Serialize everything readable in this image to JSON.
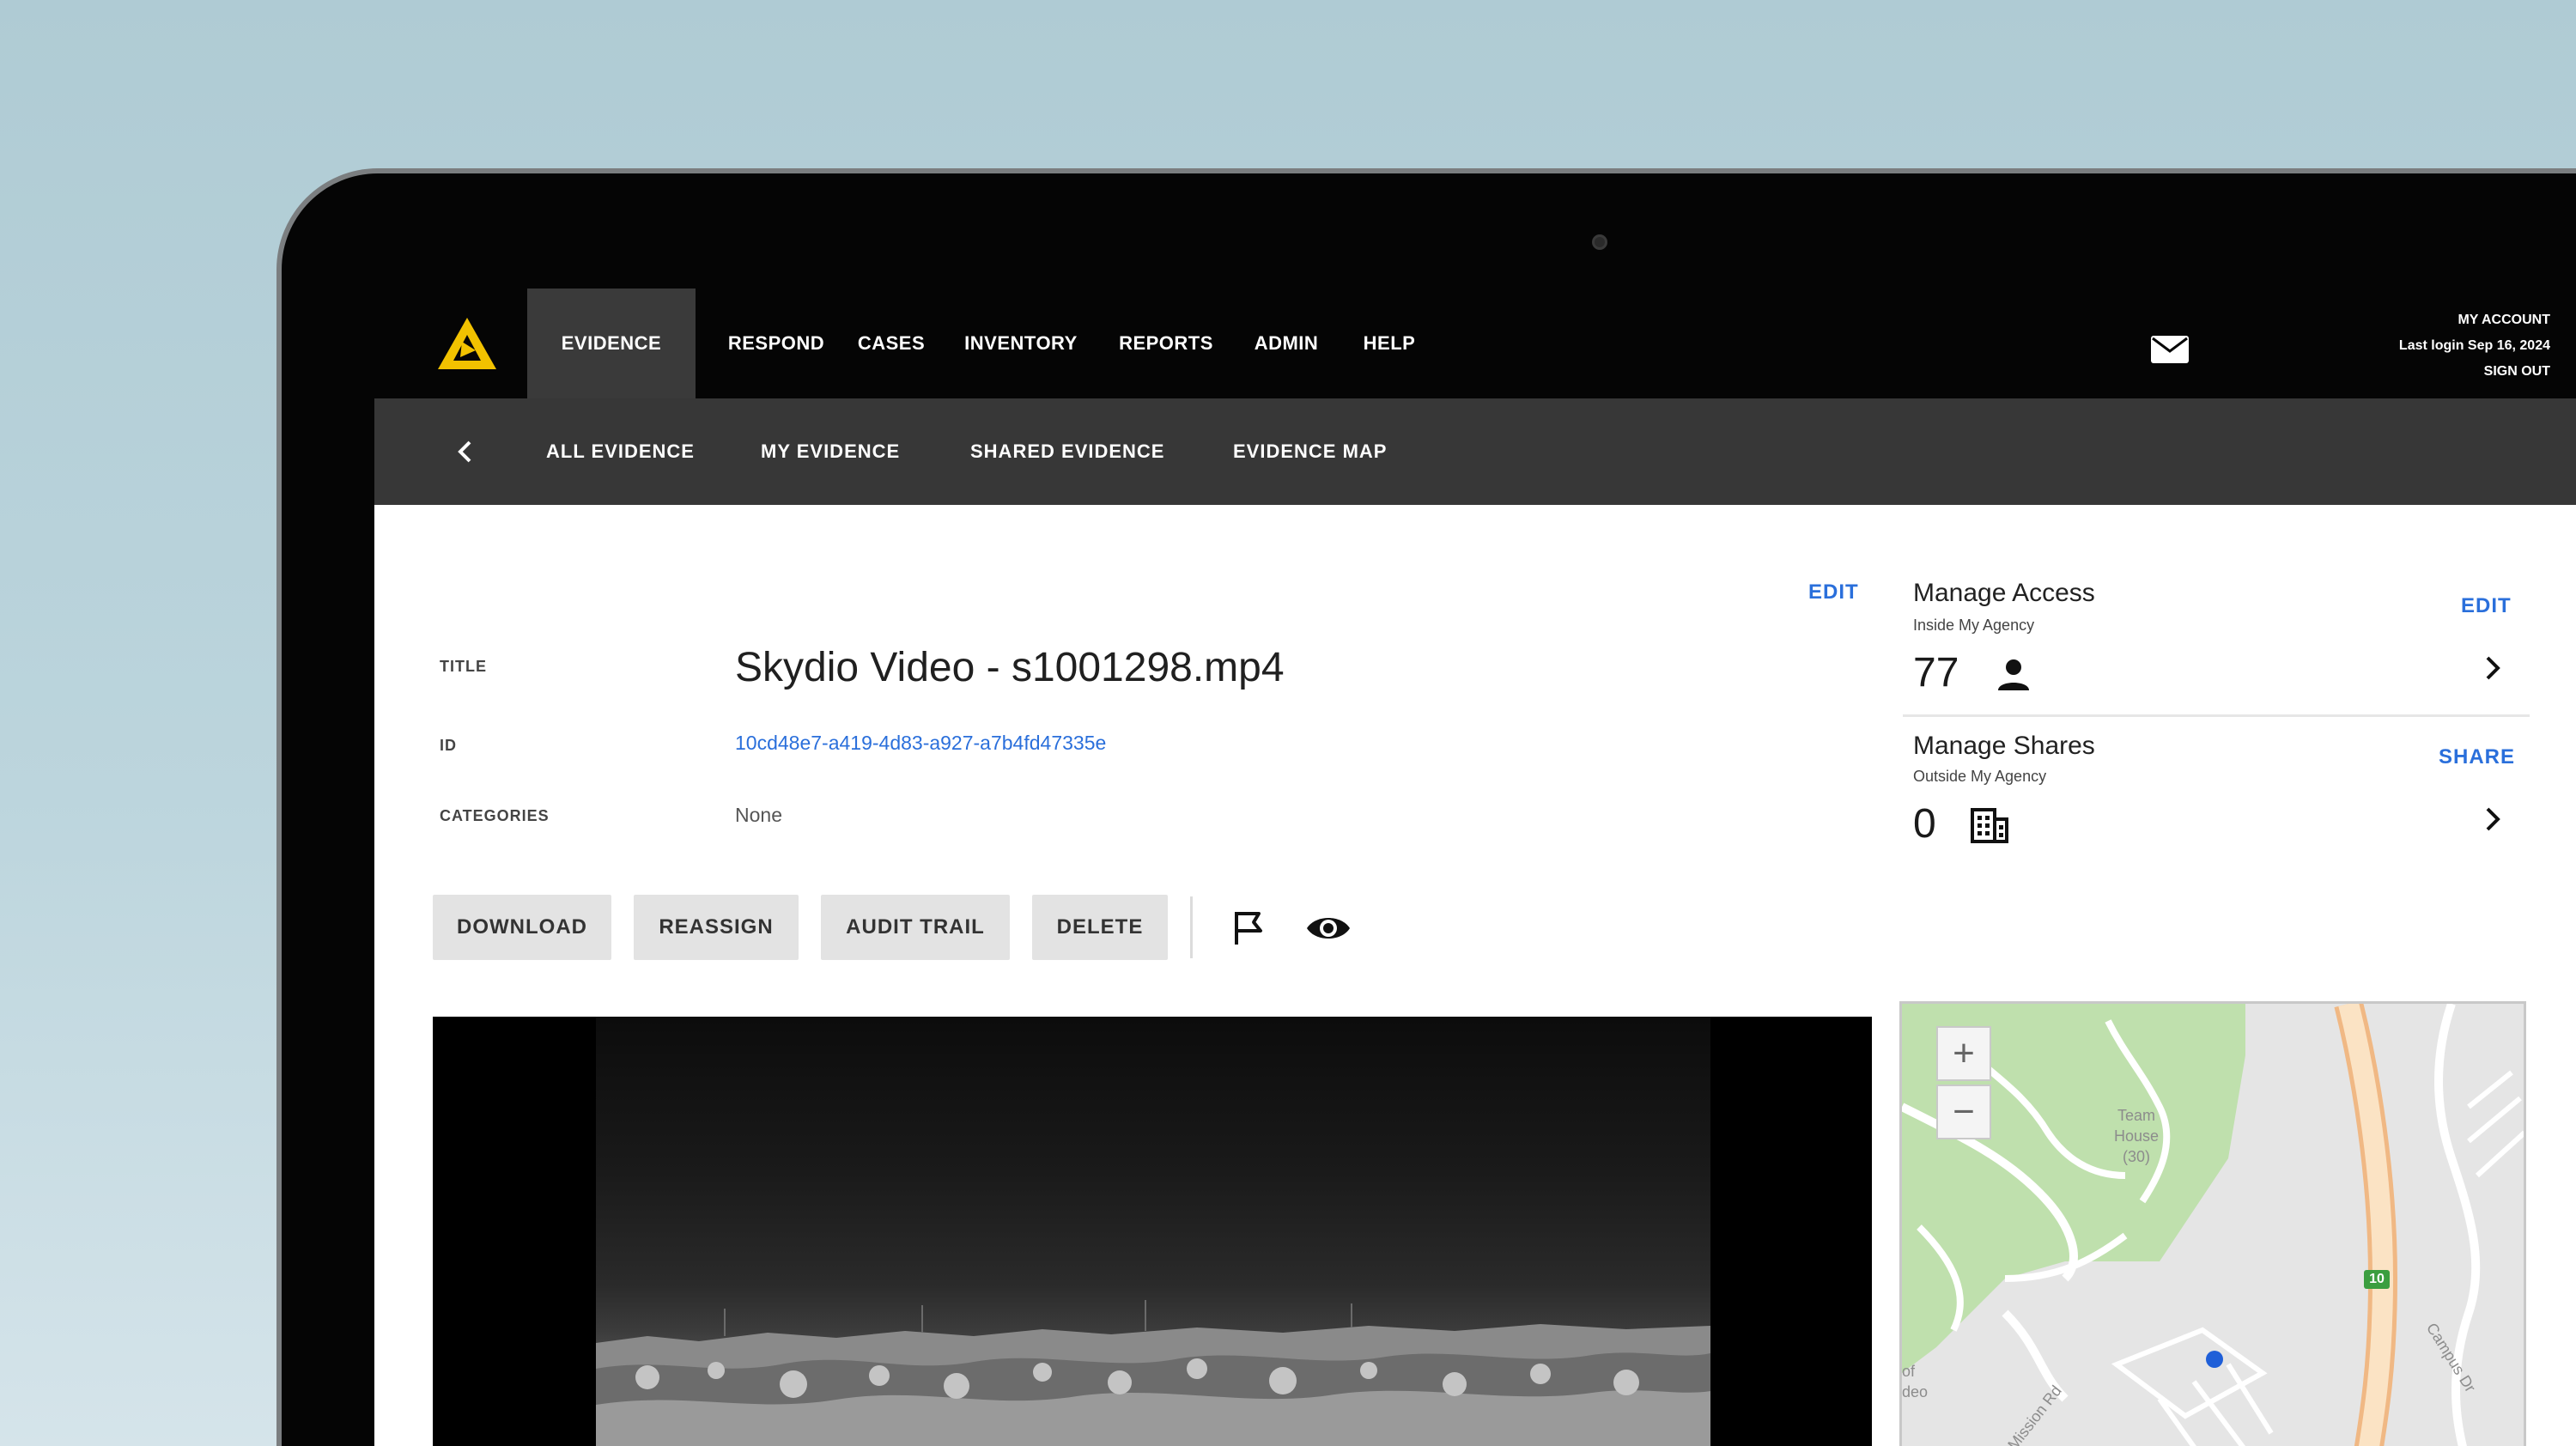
{
  "nav": {
    "items": [
      "EVIDENCE",
      "RESPOND",
      "CASES",
      "INVENTORY",
      "REPORTS",
      "ADMIN",
      "HELP"
    ],
    "active": "EVIDENCE"
  },
  "account": {
    "label": "MY ACCOUNT",
    "last_login": "Last login Sep 16, 2024",
    "sign_out": "SIGN OUT"
  },
  "subnav": {
    "items": [
      "ALL EVIDENCE",
      "MY EVIDENCE",
      "SHARED EVIDENCE",
      "EVIDENCE MAP"
    ]
  },
  "details": {
    "edit_label": "EDIT",
    "title_label": "TITLE",
    "title_value": "Skydio Video - s1001298.mp4",
    "id_label": "ID",
    "id_value": "10cd48e7-a419-4d83-a927-a7b4fd47335e",
    "categories_label": "CATEGORIES",
    "categories_value": "None"
  },
  "actions": {
    "buttons": [
      "DOWNLOAD",
      "REASSIGN",
      "AUDIT TRAIL",
      "DELETE"
    ]
  },
  "access": {
    "title": "Manage Access",
    "subtitle": "Inside My Agency",
    "edit_label": "EDIT",
    "count": "77"
  },
  "shares": {
    "title": "Manage Shares",
    "subtitle": "Outside My Agency",
    "share_label": "SHARE",
    "count": "0"
  },
  "map": {
    "zoom_in": "+",
    "zoom_out": "−",
    "poi_label": [
      "Team",
      "House",
      "(30)"
    ],
    "partial_label": [
      "of",
      "deo"
    ],
    "route_badge": "10",
    "road_1": "Campus Dr",
    "road_2": "Mission Rd"
  },
  "colors": {
    "accent": "#2a6fdb",
    "nav_bg": "#050505",
    "subnav_bg": "#373737",
    "active_tab": "#3a3a3a",
    "logo_yellow": "#f2c200"
  }
}
